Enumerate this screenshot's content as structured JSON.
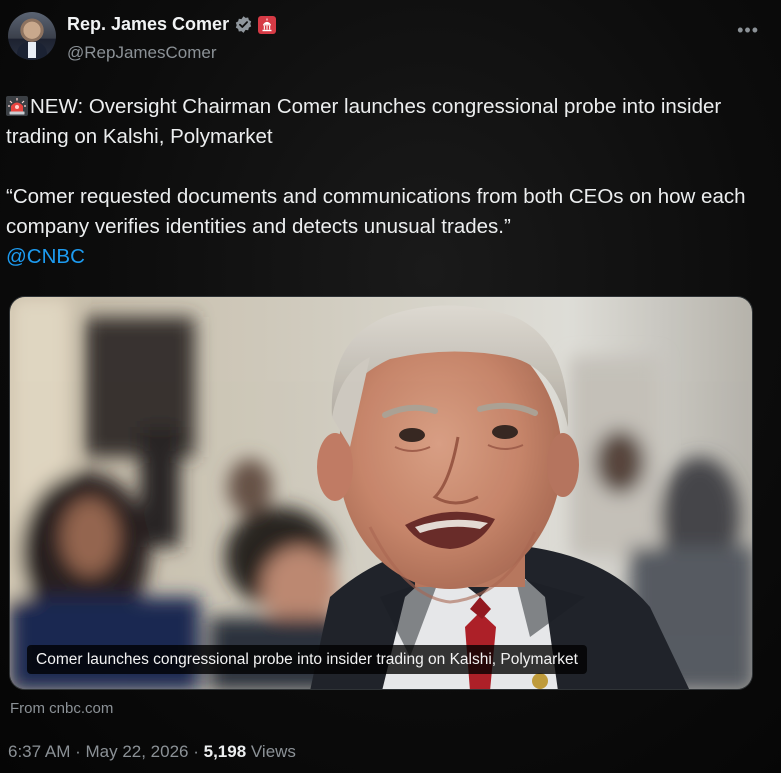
{
  "author": {
    "display_name": "Rep. James Comer",
    "handle": "@RepJamesComer",
    "verified_icon": "verified-gray-check-icon",
    "affiliation_icon": "capitol-badge-icon"
  },
  "more_label": "•••",
  "tweet": {
    "line1_rest": "NEW: Oversight Chairman Comer launches congressional probe into insider trading on Kalshi, Polymarket",
    "quote": "“Comer requested documents and communications from both CEOs on how each company verifies identities and detects unusual trades.”",
    "mention": "@CNBC"
  },
  "card": {
    "caption": "Comer launches congressional probe into insider trading on Kalshi, Polymarket",
    "source": "From cnbc.com"
  },
  "meta": {
    "time": "6:37 AM",
    "sep1": " · ",
    "date": "May 22, 2026",
    "sep2": " · ",
    "views_count": "5,198",
    "views_label": " Views"
  },
  "colors": {
    "link": "#1d9bf0",
    "muted": "#8b9196",
    "text": "#eceeef",
    "badge_red": "#d63a45"
  }
}
